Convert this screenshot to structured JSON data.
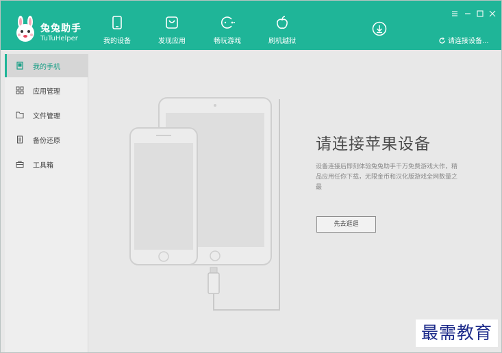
{
  "app": {
    "brand_cn": "兔兔助手",
    "brand_en": "TuTuHelper"
  },
  "nav": [
    {
      "label": "我的设备",
      "icon": "phone-icon"
    },
    {
      "label": "发现应用",
      "icon": "bag-icon"
    },
    {
      "label": "畅玩游戏",
      "icon": "gamepad-icon"
    },
    {
      "label": "刷机越狱",
      "icon": "apple-icon"
    }
  ],
  "header": {
    "download_icon": "download-icon",
    "connect_status": "请连接设备..."
  },
  "sidebar": {
    "items": [
      {
        "label": "我的手机",
        "icon": "phone-book-icon",
        "active": true
      },
      {
        "label": "应用管理",
        "icon": "grid-icon",
        "active": false
      },
      {
        "label": "文件管理",
        "icon": "folder-icon",
        "active": false
      },
      {
        "label": "备份还原",
        "icon": "backup-icon",
        "active": false
      },
      {
        "label": "工具箱",
        "icon": "toolbox-icon",
        "active": false
      }
    ]
  },
  "main": {
    "headline": "请连接苹果设备",
    "description": "设备连接后即刻体验兔兔助手千万免费游戏大作，精品应用任你下载，无限金币和汉化版游戏全网数量之最",
    "button_label": "先去逛逛"
  },
  "watermark": "最需教育",
  "colors": {
    "accent": "#1fb598",
    "background": "#e8e8e8",
    "sidebar": "#eeeeee"
  }
}
